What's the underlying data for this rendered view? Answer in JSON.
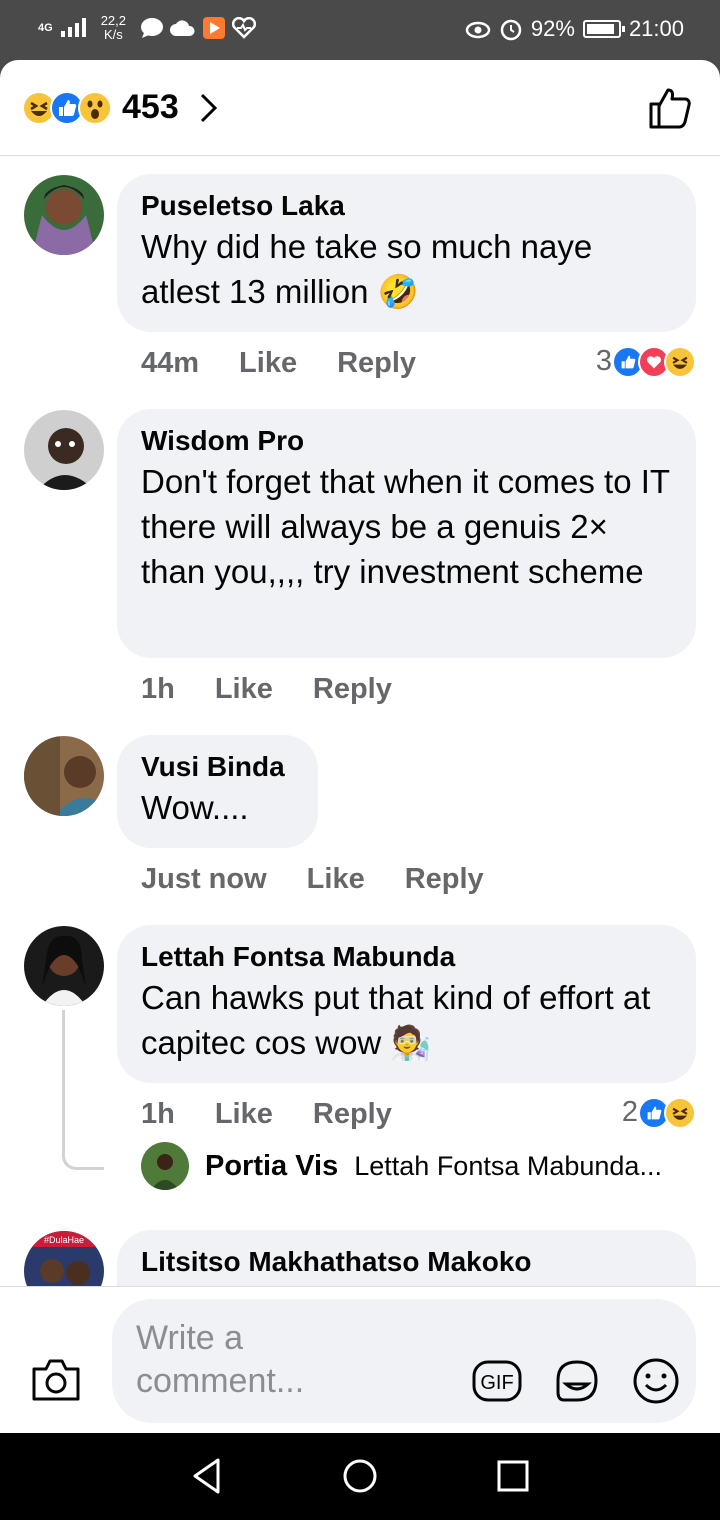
{
  "status_bar": {
    "network": "4G",
    "speed_value": "22,2",
    "speed_unit": "K/s",
    "battery": "92%",
    "time": "21:00"
  },
  "header": {
    "reaction_count": "453"
  },
  "comments": [
    {
      "author": "Puseletso Laka",
      "text": "Why did he take so much naye atlest 13 million 🤣",
      "time": "44m",
      "like_label": "Like",
      "reply_label": "Reply",
      "reaction_count": "3"
    },
    {
      "author": "Wisdom Pro",
      "text": "Don't forget that when it comes to IT there will always be a genuis 2× than you,,,, try investment scheme",
      "time": "1h",
      "like_label": "Like",
      "reply_label": "Reply"
    },
    {
      "author": "Vusi Binda",
      "text": "Wow....",
      "time": "Just now",
      "like_label": "Like",
      "reply_label": "Reply"
    },
    {
      "author": "Lettah Fontsa Mabunda",
      "text": "Can hawks put that kind of effort at capitec cos wow 🧑‍🔬",
      "time": "1h",
      "like_label": "Like",
      "reply_label": "Reply",
      "reaction_count": "2",
      "reply_preview": {
        "author": "Portia Vis",
        "text": "Lettah Fontsa Mabunda..."
      }
    },
    {
      "author": "Litsitso Makhathatso Makoko",
      "avatar_tag": "#DulaHae"
    }
  ],
  "composer": {
    "placeholder": "Write a comment...",
    "gif_label": "GIF"
  },
  "colors": {
    "facebook_blue": "#1877f2",
    "bubble_bg": "#f0f2f5",
    "meta_gray": "#65676b"
  }
}
